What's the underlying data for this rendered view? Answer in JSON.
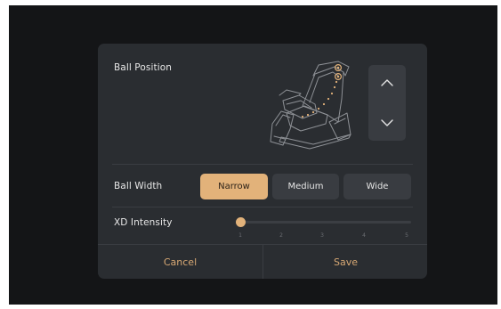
{
  "ball_position": {
    "label": "Ball Position",
    "up_icon": "chevron-up-icon",
    "down_icon": "chevron-down-icon",
    "chair_icon": "massage-chair-icon"
  },
  "ball_width": {
    "label": "Ball Width",
    "options": [
      "Narrow",
      "Medium",
      "Wide"
    ],
    "selected": "Narrow"
  },
  "xd_intensity": {
    "label": "XD Intensity",
    "ticks": [
      "1",
      "2",
      "3",
      "4",
      "5"
    ],
    "value": 1
  },
  "footer": {
    "cancel_label": "Cancel",
    "save_label": "Save"
  },
  "colors": {
    "background": "#141517",
    "dialog": "#2a2d31",
    "control": "#393c41",
    "accent": "#e2b27a",
    "accent_text": "#d7a874"
  }
}
